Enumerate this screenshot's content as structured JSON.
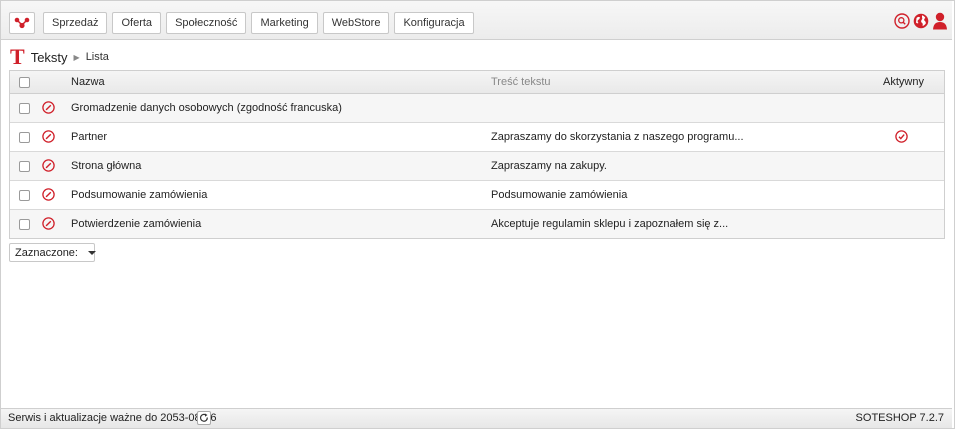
{
  "colors": {
    "accent": "#d0202a"
  },
  "topbar": {
    "logo_icon": "share-nodes-icon",
    "menu": [
      {
        "label": "Sprzedaż"
      },
      {
        "label": "Oferta"
      },
      {
        "label": "Społeczność"
      },
      {
        "label": "Marketing"
      },
      {
        "label": "WebStore"
      },
      {
        "label": "Konfiguracja"
      }
    ],
    "right_icons": [
      "search-icon",
      "globe-icon",
      "user-icon"
    ]
  },
  "breadcrumb": {
    "section_icon_letter": "T",
    "section": "Teksty",
    "current": "Lista"
  },
  "table": {
    "columns": {
      "name": "Nazwa",
      "text": "Treść tekstu",
      "active": "Aktywny"
    },
    "rows": [
      {
        "name": "Gromadzenie danych osobowych (zgodność francuska)",
        "text": "",
        "active": false
      },
      {
        "name": "Partner",
        "text": "Zapraszamy do skorzystania z naszego programu...",
        "active": true
      },
      {
        "name": "Strona główna",
        "text": "Zapraszamy na zakupy.",
        "active": false
      },
      {
        "name": "Podsumowanie zamówienia",
        "text": "Podsumowanie zamówienia",
        "active": false
      },
      {
        "name": "Potwierdzenie zamówienia",
        "text": "Akceptuje regulamin sklepu i zapoznałem się z...",
        "active": false
      }
    ]
  },
  "selection": {
    "label": "Zaznaczone:"
  },
  "footer": {
    "service": "Serwis i aktualizacje ważne do 2053-08-26",
    "version": "SOTESHOP 7.2.7"
  }
}
